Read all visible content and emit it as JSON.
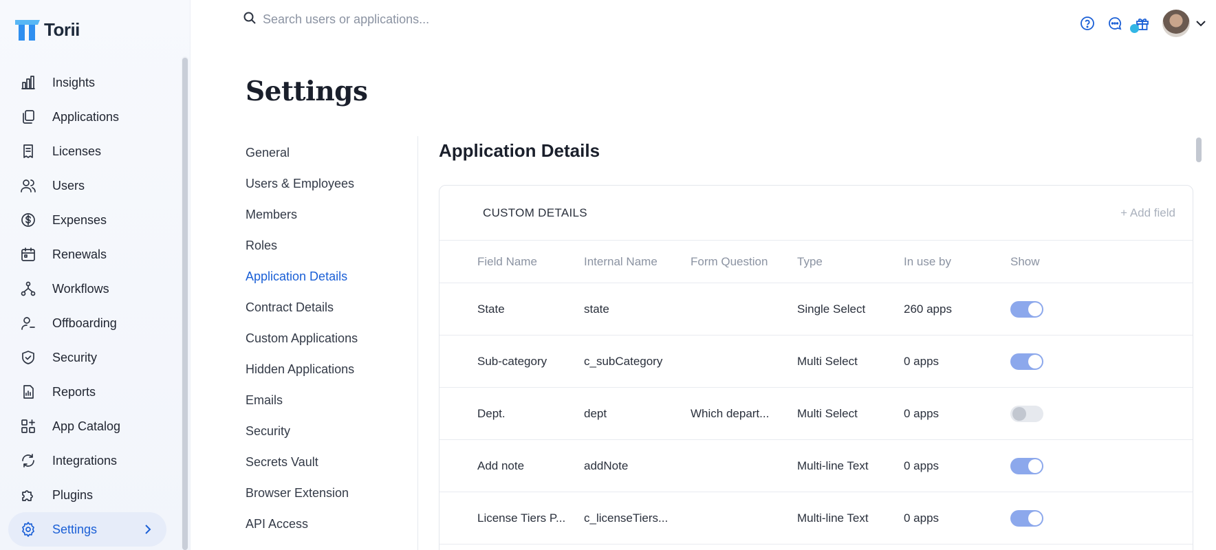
{
  "app": {
    "name": "Torii",
    "colors": {
      "accent": "#1a5fd6",
      "logo_blue": "#2f8ff0",
      "logo_light": "#58b7f5",
      "toggle_on": "#8ca8ec"
    }
  },
  "search": {
    "placeholder": "Search users or applications..."
  },
  "sidebar": {
    "items": [
      {
        "label": "Insights",
        "icon": "bar-chart-icon"
      },
      {
        "label": "Applications",
        "icon": "copy-icon"
      },
      {
        "label": "Licenses",
        "icon": "receipt-icon"
      },
      {
        "label": "Users",
        "icon": "users-icon"
      },
      {
        "label": "Expenses",
        "icon": "dollar-icon"
      },
      {
        "label": "Renewals",
        "icon": "calendar-icon"
      },
      {
        "label": "Workflows",
        "icon": "workflow-icon"
      },
      {
        "label": "Offboarding",
        "icon": "user-minus-icon"
      },
      {
        "label": "Security",
        "icon": "shield-icon"
      },
      {
        "label": "Reports",
        "icon": "report-icon"
      },
      {
        "label": "App Catalog",
        "icon": "grid-plus-icon"
      },
      {
        "label": "Integrations",
        "icon": "refresh-icon"
      },
      {
        "label": "Plugins",
        "icon": "puzzle-icon"
      },
      {
        "label": "Settings",
        "icon": "gear-icon",
        "active": true
      }
    ]
  },
  "page": {
    "title": "Settings"
  },
  "subnav": {
    "items": [
      "General",
      "Users & Employees",
      "Members",
      "Roles",
      "Application Details",
      "Contract Details",
      "Custom Applications",
      "Hidden Applications",
      "Emails",
      "Security",
      "Secrets Vault",
      "Browser Extension",
      "API Access"
    ],
    "active_index": 4
  },
  "section": {
    "title": "Application Details",
    "card_title": "CUSTOM DETAILS",
    "add_field": "+ Add field"
  },
  "table": {
    "columns": [
      "Field Name",
      "Internal Name",
      "Form Question",
      "Type",
      "In use by",
      "Show"
    ],
    "rows": [
      {
        "field_name": "State",
        "internal_name": "state",
        "form_question": "",
        "type": "Single Select",
        "in_use_by": "260 apps",
        "show": true
      },
      {
        "field_name": "Sub-category",
        "internal_name": "c_subCategory",
        "form_question": "",
        "type": "Multi Select",
        "in_use_by": "0 apps",
        "show": true
      },
      {
        "field_name": "Dept.",
        "internal_name": "dept",
        "form_question": "Which depart...",
        "type": "Multi Select",
        "in_use_by": "0 apps",
        "show": false
      },
      {
        "field_name": "Add note",
        "internal_name": "addNote",
        "form_question": "",
        "type": "Multi-line Text",
        "in_use_by": "0 apps",
        "show": true
      },
      {
        "field_name": "License Tiers P...",
        "internal_name": "c_licenseTiers...",
        "form_question": "",
        "type": "Multi-line Text",
        "in_use_by": "0 apps",
        "show": true
      }
    ]
  }
}
